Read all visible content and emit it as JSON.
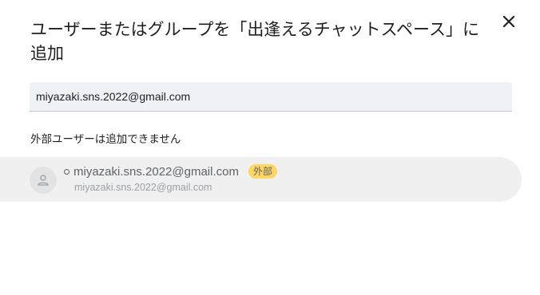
{
  "dialog": {
    "title": "ユーザーまたはグループを「出逢えるチャットスペース」に追加",
    "close_icon": "close-icon"
  },
  "search": {
    "value": "miyazaki.sns.2022@gmail.com"
  },
  "warning": {
    "text": "外部ユーザーは追加できません"
  },
  "result": {
    "avatar_icon": "person-icon",
    "status_icon": "status-circle-icon",
    "primary": "miyazaki.sns.2022@gmail.com",
    "badge": "外部",
    "secondary": "miyazaki.sns.2022@gmail.com"
  },
  "colors": {
    "badge_bg": "#fdd663",
    "row_bg": "#f0f0f0",
    "field_bg": "#eef1f6"
  }
}
